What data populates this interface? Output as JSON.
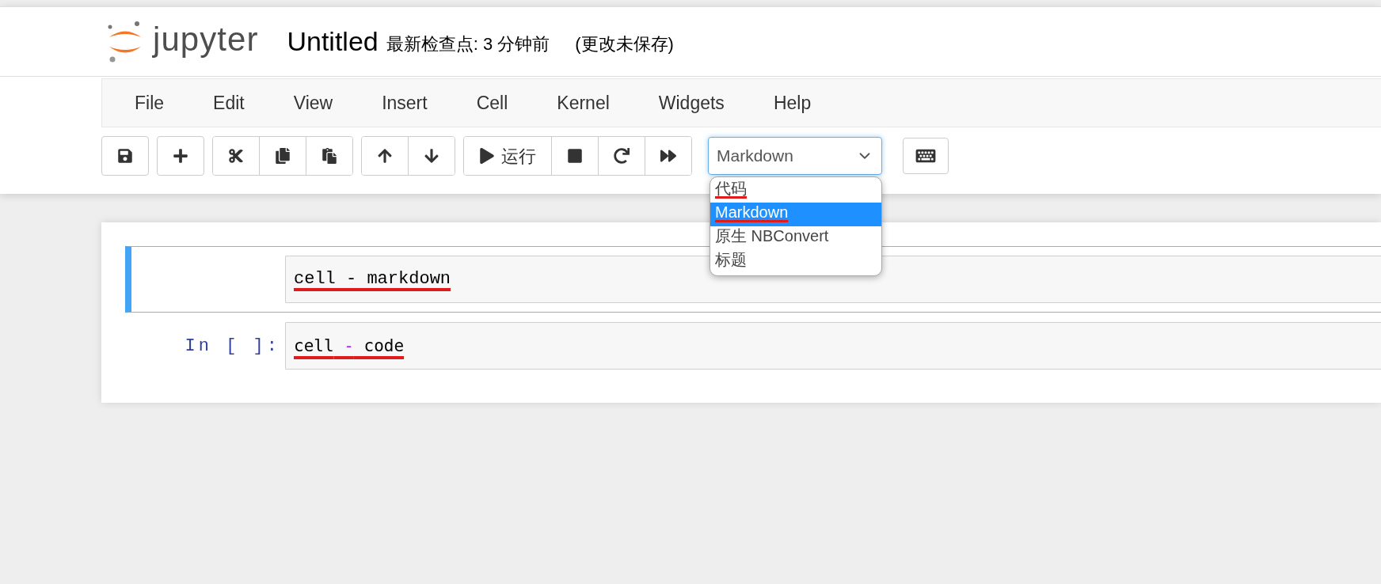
{
  "header": {
    "logo_text": "jupyter",
    "notebook_name": "Untitled",
    "checkpoint": "最新检查点: 3 分钟前",
    "save_status": "(更改未保存)"
  },
  "menu": [
    "File",
    "Edit",
    "View",
    "Insert",
    "Cell",
    "Kernel",
    "Widgets",
    "Help"
  ],
  "toolbar": [
    [
      {
        "kind": "save"
      }
    ],
    [
      {
        "kind": "insert"
      }
    ],
    [
      {
        "kind": "cut"
      },
      {
        "kind": "copy"
      },
      {
        "kind": "paste"
      }
    ],
    [
      {
        "kind": "move-up"
      },
      {
        "kind": "move-down"
      }
    ],
    [
      {
        "kind": "run",
        "label": "运行"
      },
      {
        "kind": "stop"
      },
      {
        "kind": "restart"
      },
      {
        "kind": "run-all"
      }
    ]
  ],
  "cell_type_select": {
    "value": "Markdown",
    "expanded": true,
    "options": [
      {
        "label": "代码",
        "selected": false,
        "underlined": true
      },
      {
        "label": "Markdown",
        "selected": true,
        "underlined": true
      },
      {
        "label": "原生 NBConvert",
        "selected": false,
        "underlined": false
      },
      {
        "label": "标题",
        "selected": false,
        "underlined": false
      }
    ]
  },
  "cells": [
    {
      "kind": "markdown",
      "selected": true,
      "underlined": true,
      "tokens": [
        {
          "text": "cell - markdown",
          "kind": "text"
        }
      ]
    },
    {
      "kind": "code",
      "selected": false,
      "underlined": true,
      "prompt": "In [ ]:",
      "tokens": [
        {
          "text": "cell",
          "kind": "name"
        },
        {
          "text": "-",
          "kind": "operator"
        },
        {
          "text": "code",
          "kind": "name"
        }
      ]
    }
  ]
}
